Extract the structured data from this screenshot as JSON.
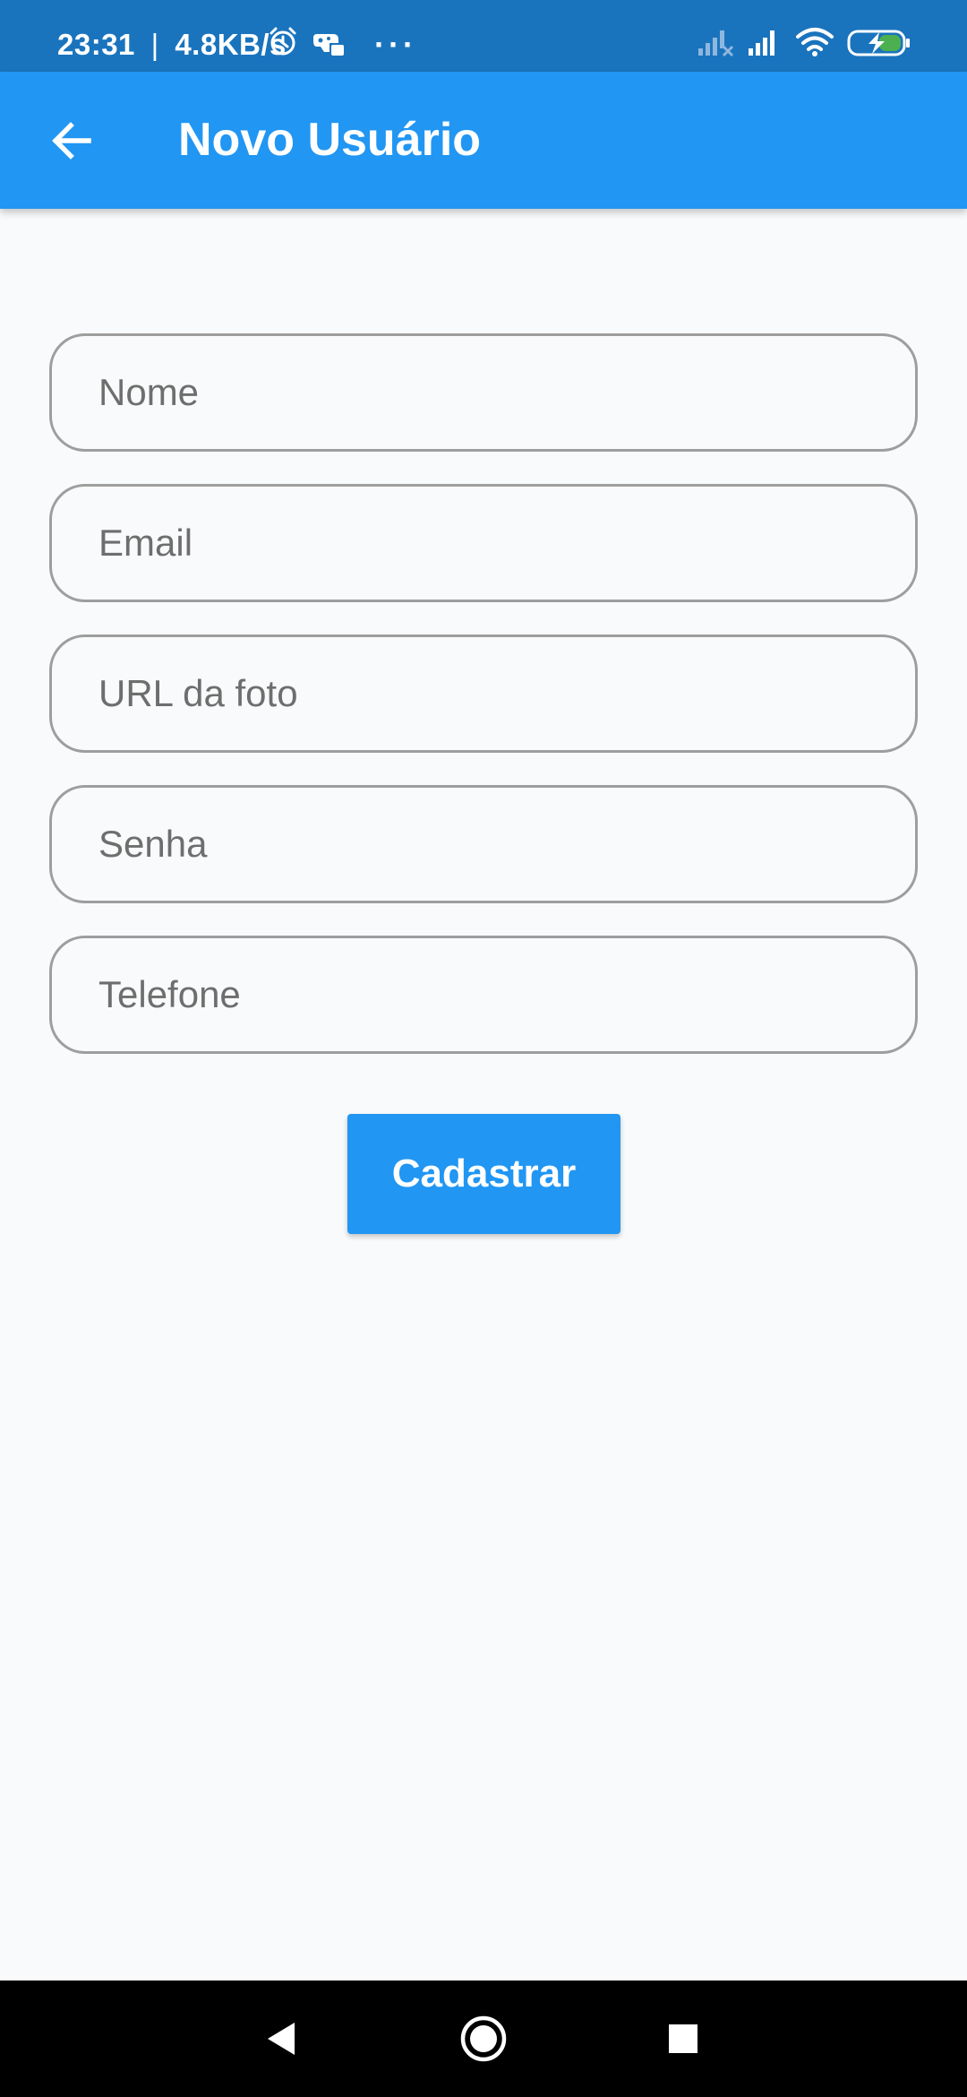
{
  "status_bar": {
    "time": "23:31",
    "separator": "|",
    "network_speed": "4.8KB/s",
    "icons": [
      "alarm-icon",
      "game-icon",
      "more-dots-icon",
      "signal-no-sim-icon",
      "signal-icon",
      "wifi-icon",
      "battery-charging-icon"
    ],
    "dots": "···"
  },
  "app_bar": {
    "back_icon": "arrow-back-icon",
    "title": "Novo Usuário"
  },
  "form": {
    "fields": [
      {
        "name": "nome",
        "placeholder": "Nome",
        "value": ""
      },
      {
        "name": "email",
        "placeholder": "Email",
        "value": ""
      },
      {
        "name": "url-foto",
        "placeholder": "URL da foto",
        "value": ""
      },
      {
        "name": "senha",
        "placeholder": "Senha",
        "value": ""
      },
      {
        "name": "telefone",
        "placeholder": "Telefone",
        "value": ""
      }
    ],
    "submit_label": "Cadastrar"
  },
  "nav_bar": {
    "icons": [
      "back-triangle-icon",
      "home-circle-icon",
      "recents-square-icon"
    ]
  },
  "colors": {
    "primary": "#2196f3",
    "status_bar": "#1a74bd",
    "background": "#f9fafb",
    "field_border": "#9e9e9e",
    "placeholder": "#6e6e6e",
    "battery_fill": "#4caf50"
  }
}
